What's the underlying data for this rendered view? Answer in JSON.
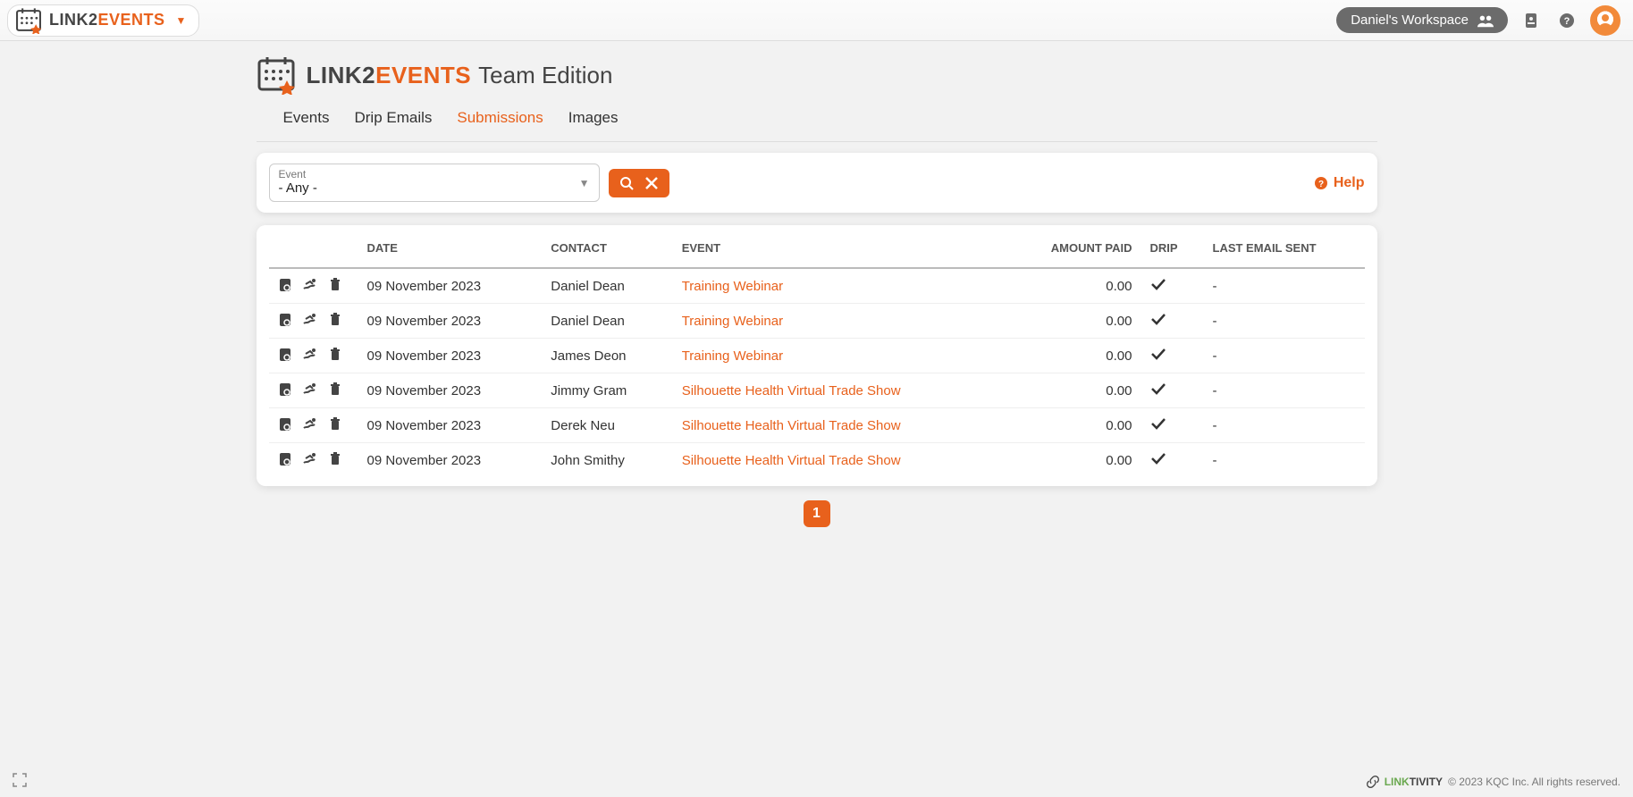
{
  "colors": {
    "accent": "#e8611c"
  },
  "topbar": {
    "brand_link2": "LINK2",
    "brand_events": "EVENTS",
    "workspace_label": "Daniel's Workspace"
  },
  "header": {
    "brand_link2": "LINK2",
    "brand_events": "EVENTS",
    "edition": "Team Edition"
  },
  "tabs": {
    "events": "Events",
    "drip_emails": "Drip Emails",
    "submissions": "Submissions",
    "images": "Images",
    "active": "submissions"
  },
  "filter": {
    "event_label": "Event",
    "event_value": "- Any -",
    "help_label": "Help"
  },
  "table": {
    "headers": {
      "date": "DATE",
      "contact": "CONTACT",
      "event": "EVENT",
      "amount_paid": "AMOUNT PAID",
      "drip": "DRIP",
      "last_email_sent": "LAST EMAIL SENT"
    },
    "rows": [
      {
        "date": "09 November 2023",
        "contact": "Daniel Dean",
        "event": "Training Webinar",
        "amount": "0.00",
        "drip": true,
        "last_email": "-"
      },
      {
        "date": "09 November 2023",
        "contact": "Daniel Dean",
        "event": "Training Webinar",
        "amount": "0.00",
        "drip": true,
        "last_email": "-"
      },
      {
        "date": "09 November 2023",
        "contact": "James Deon",
        "event": "Training Webinar",
        "amount": "0.00",
        "drip": true,
        "last_email": "-"
      },
      {
        "date": "09 November 2023",
        "contact": "Jimmy Gram",
        "event": "Silhouette Health Virtual Trade Show",
        "amount": "0.00",
        "drip": true,
        "last_email": "-"
      },
      {
        "date": "09 November 2023",
        "contact": "Derek Neu",
        "event": "Silhouette Health Virtual Trade Show",
        "amount": "0.00",
        "drip": true,
        "last_email": "-"
      },
      {
        "date": "09 November 2023",
        "contact": "John Smithy",
        "event": "Silhouette Health Virtual Trade Show",
        "amount": "0.00",
        "drip": true,
        "last_email": "-"
      }
    ]
  },
  "pagination": {
    "pages": [
      "1"
    ],
    "current": "1"
  },
  "footer": {
    "brand_link": "LINK",
    "brand_tivity": "TIVITY",
    "copyright": "© 2023 KQC Inc. All rights reserved."
  }
}
